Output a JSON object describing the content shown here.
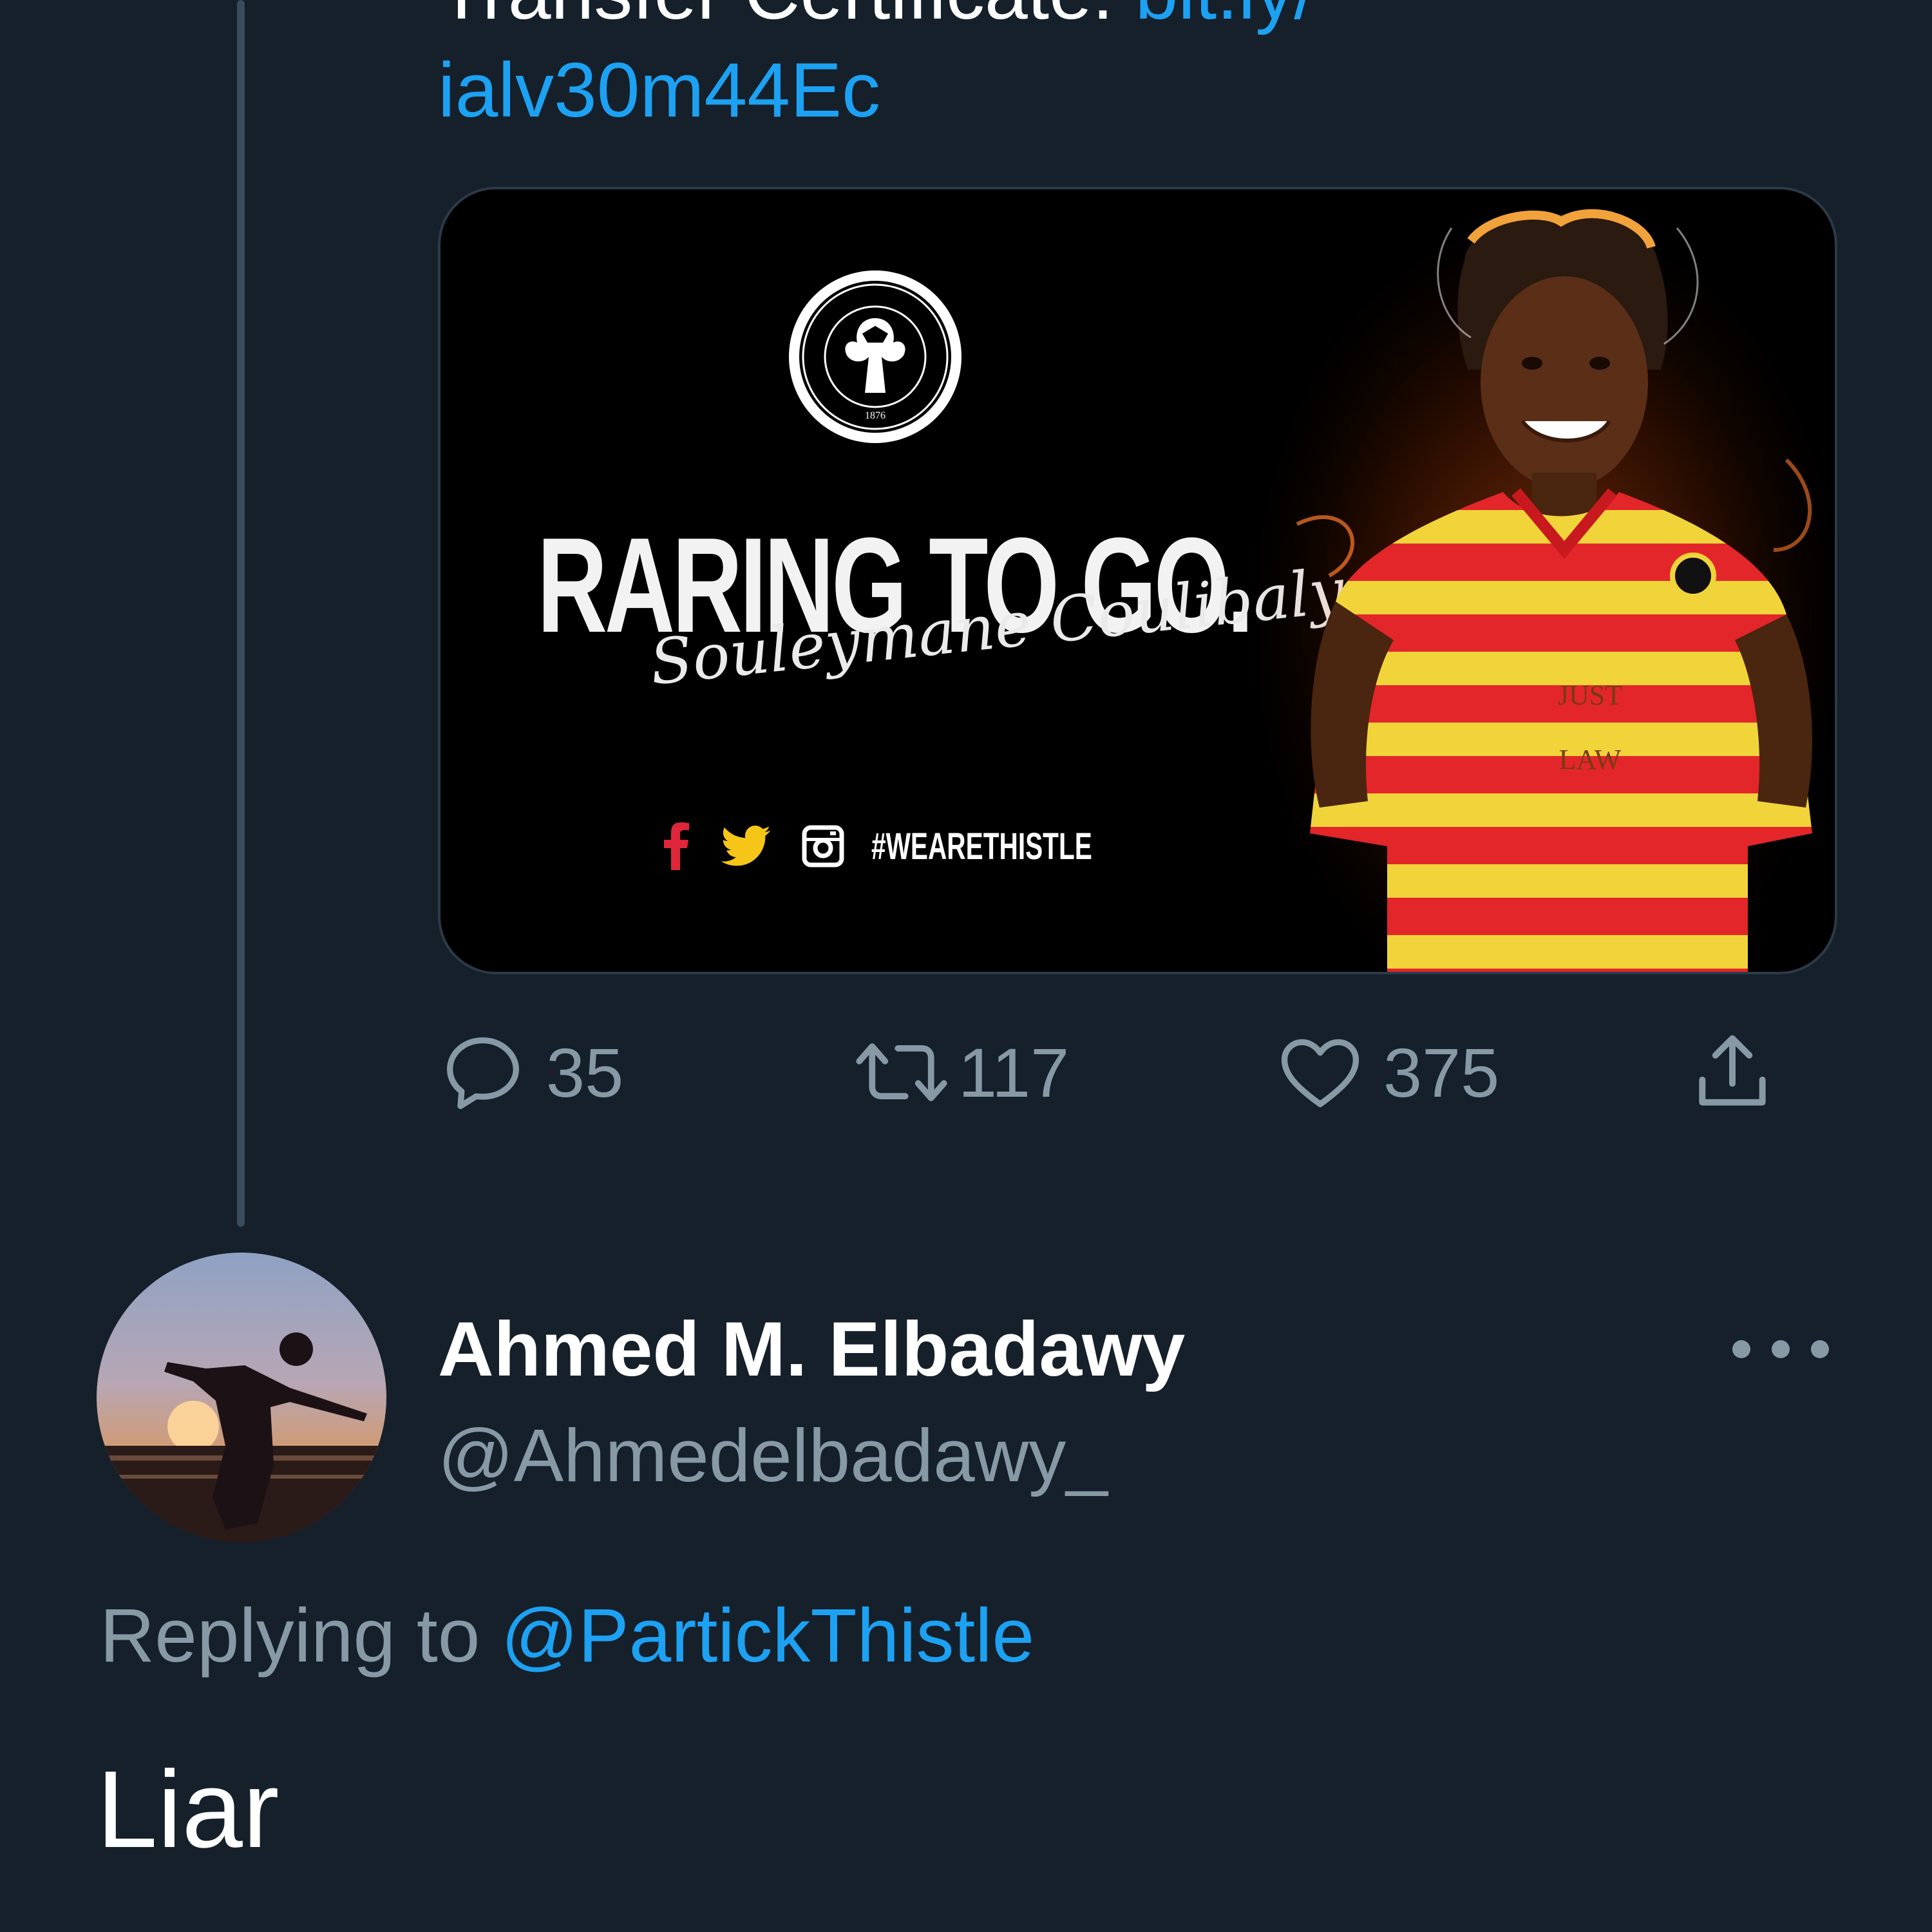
{
  "previous_tweet": {
    "text_partial_line": "Transfer Certificate.",
    "link_partial_line": "bit.ly/",
    "link_continuation": "ialv30m44Ec",
    "media": {
      "headline": "RARING TO GO.",
      "signature": "Souleymane Coulibaly",
      "hashtag": "#WEARETHISTLE",
      "social_icons": [
        "facebook-icon",
        "twitter-icon",
        "instagram-icon"
      ]
    },
    "actions": {
      "reply_count": "35",
      "retweet_count": "117",
      "like_count": "375"
    }
  },
  "reply_tweet": {
    "display_name": "Ahmed M. Elbadawy",
    "handle": "@Ahmedelbadawy_",
    "replying_prefix": "Replying to ",
    "replying_to": "@PartickThistle",
    "text": "Liar"
  },
  "colors": {
    "background": "#15202b",
    "link": "#1da1f2",
    "muted": "#8899a6",
    "thread_line": "#3a4b5c"
  }
}
